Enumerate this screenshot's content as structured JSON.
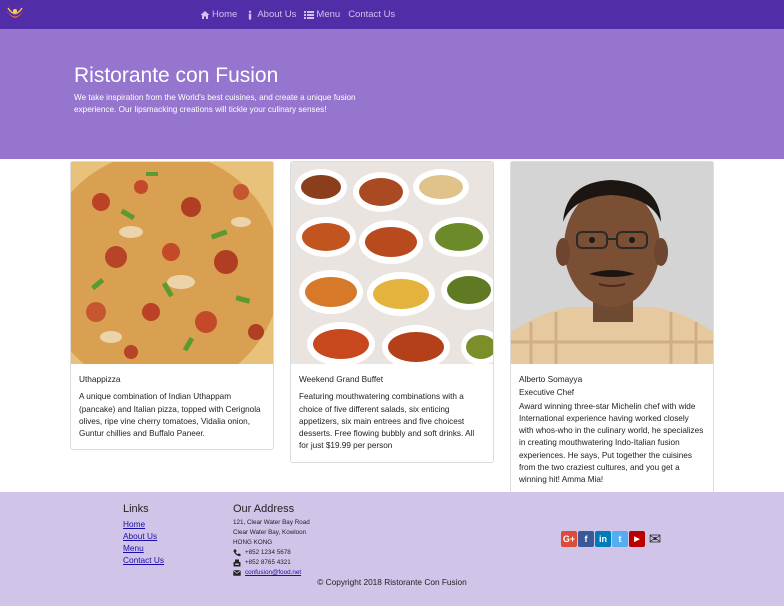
{
  "navbar": {
    "logo_icon": "restaurant-logo",
    "links": [
      {
        "label": "Home",
        "icon": "home-icon"
      },
      {
        "label": "About Us",
        "icon": "info-icon"
      },
      {
        "label": "Menu",
        "icon": "list-icon"
      },
      {
        "label": "Contact Us",
        "icon": "address-card-icon"
      }
    ]
  },
  "jumbotron": {
    "title": "Ristorante con Fusion",
    "text": "We take inspiration from the World's best cuisines, and create a unique fusion experience. Our lipsmacking creations will tickle your culinary senses!"
  },
  "cards": [
    {
      "title": "Uthappizza",
      "description": "A unique combination of Indian Uthappam (pancake) and Italian pizza, topped with Cerignola olives, ripe vine cherry tomatoes, Vidalia onion, Guntur chillies and Buffalo Paneer.",
      "image": "pizza-image"
    },
    {
      "title": "Weekend Grand Buffet",
      "description": "Featuring mouthwatering combinations with a choice of five different salads, six enticing appetizers, six main entrees and five choicest desserts. Free flowing bubbly and soft drinks. All for just $19.99 per person",
      "image": "buffet-image"
    },
    {
      "title": "Alberto Somayya",
      "subtitle": "Executive Chef",
      "description": "Award winning three-star Michelin chef with wide International experience having worked closely with whos-who in the culinary world, he specializes in creating mouthwatering Indo-Italian fusion experiences. He says, Put together the cuisines from the two craziest cultures, and you get a winning hit! Amma Mia!",
      "image": "chef-portrait-image"
    }
  ],
  "footer": {
    "links_heading": "Links",
    "links": [
      "Home",
      "About Us",
      "Menu",
      "Contact Us"
    ],
    "address_heading": "Our Address",
    "address_lines": [
      "121, Clear Water Bay Road",
      "Clear Water Bay, Kowloon",
      "HONG KONG"
    ],
    "phone": "+852 1234 5678",
    "fax": "+852 8765 4321",
    "email": "confusion@food.net",
    "social": [
      {
        "name": "google-plus-icon",
        "color": "#dd4b39",
        "glyph": "G+"
      },
      {
        "name": "facebook-icon",
        "color": "#3b5998",
        "glyph": "f"
      },
      {
        "name": "linkedin-icon",
        "color": "#007bb6",
        "glyph": "in"
      },
      {
        "name": "twitter-icon",
        "color": "#55acee",
        "glyph": "t"
      },
      {
        "name": "youtube-icon",
        "color": "#bb0000",
        "glyph": "▶"
      },
      {
        "name": "mail-icon",
        "color": "transparent",
        "glyph": "✉"
      }
    ],
    "copyright": "© Copyright 2018 Ristorante Con Fusion"
  },
  "colors": {
    "navbar": "#512da8",
    "jumbotron": "#9575cd",
    "footer": "#d1c4e9"
  }
}
